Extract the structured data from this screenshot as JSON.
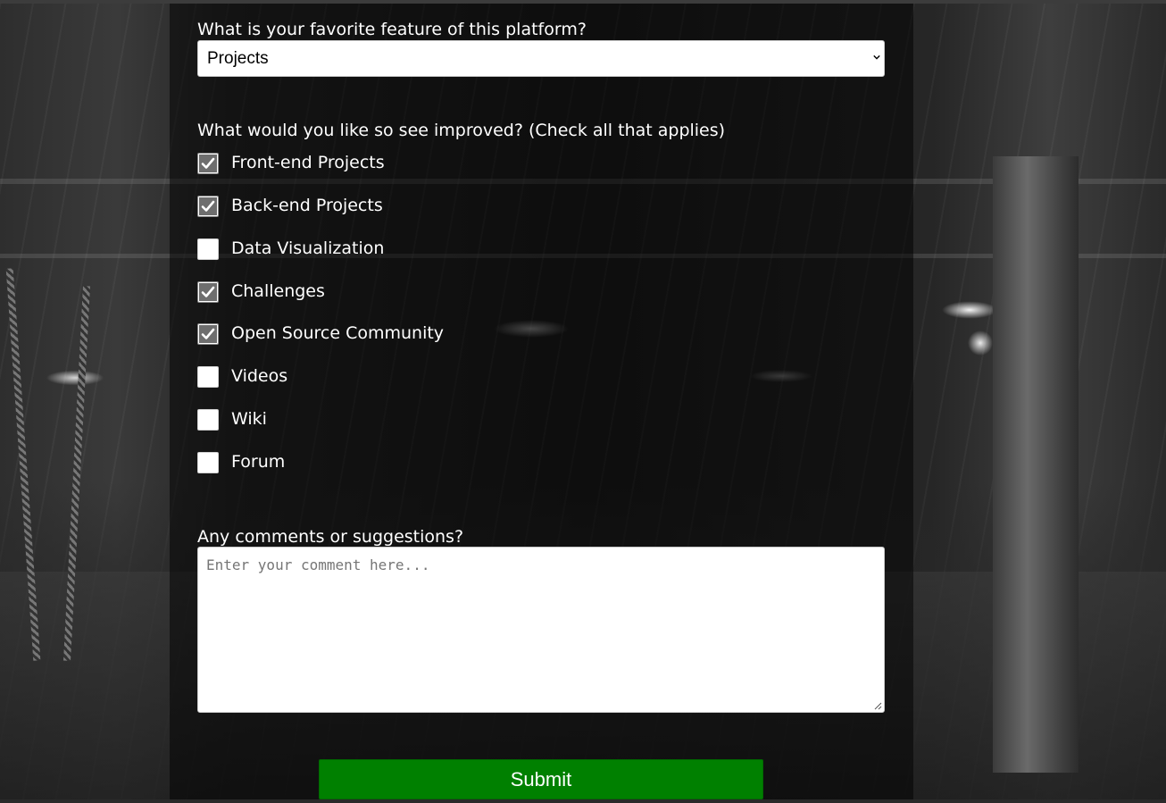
{
  "form": {
    "favorite_question": "What is your favorite feature of this platform?",
    "favorite_selected": "Projects",
    "improve_question": "What would you like so see improved? (Check all that applies)",
    "improvements": [
      {
        "label": "Front-end Projects",
        "checked": true
      },
      {
        "label": "Back-end Projects",
        "checked": true
      },
      {
        "label": "Data Visualization",
        "checked": false
      },
      {
        "label": "Challenges",
        "checked": true
      },
      {
        "label": "Open Source Community",
        "checked": true
      },
      {
        "label": "Videos",
        "checked": false
      },
      {
        "label": "Wiki",
        "checked": false
      },
      {
        "label": "Forum",
        "checked": false
      }
    ],
    "comments_question": "Any comments or suggestions?",
    "comments_placeholder": "Enter your comment here...",
    "submit_label": "Submit"
  },
  "colors": {
    "submit_bg": "#008000",
    "panel_overlay": "rgba(0,0,0,0.5)"
  }
}
